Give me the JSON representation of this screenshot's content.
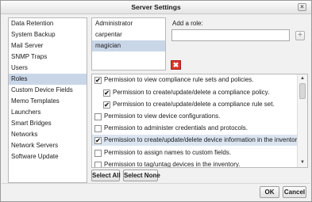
{
  "dialog": {
    "title": "Server Settings",
    "close_glyph": "×"
  },
  "sidebar": {
    "items": [
      "Data Retention",
      "System Backup",
      "Mail Server",
      "SNMP Traps",
      "Users",
      "Roles",
      "Custom Device Fields",
      "Memo Templates",
      "Launchers",
      "Smart Bridges",
      "Networks",
      "Network Servers",
      "Software Update"
    ],
    "selected": "Roles"
  },
  "roles": {
    "items": [
      "Administrator",
      "carpentar",
      "magician"
    ],
    "selected": "magician"
  },
  "add_role": {
    "label": "Add a role:",
    "value": "",
    "add_glyph": "+",
    "delete_glyph": "✖"
  },
  "permissions": [
    {
      "label": "Permission to view compliance rule sets and policies.",
      "checked": true,
      "indent": 0
    },
    {
      "label": "Permission to create/update/delete a compliance policy.",
      "checked": true,
      "indent": 1
    },
    {
      "label": "Permission to create/update/delete a compliance rule set.",
      "checked": true,
      "indent": 1
    },
    {
      "label": "Permission to view device configurations.",
      "checked": false,
      "indent": 0
    },
    {
      "label": "Permission to administer credentials and protocols.",
      "checked": false,
      "indent": 0
    },
    {
      "label": "Permission to create/update/delete device information in the inventory.",
      "checked": true,
      "indent": 0,
      "highlighted": true
    },
    {
      "label": "Permission to assign names to custom fields.",
      "checked": false,
      "indent": 0
    },
    {
      "label": "Permission to tag/untag devices in the inventory.",
      "checked": false,
      "indent": 0
    }
  ],
  "scroll": {
    "up_glyph": "▲",
    "down_glyph": "▼"
  },
  "buttons": {
    "select_all": "Select All",
    "select_none": "Select None",
    "ok": "OK",
    "cancel": "Cancel"
  },
  "colors": {
    "selection": "#c9d6e8",
    "highlight_row": "#dbe5f1",
    "delete_red": "#d9342b"
  }
}
